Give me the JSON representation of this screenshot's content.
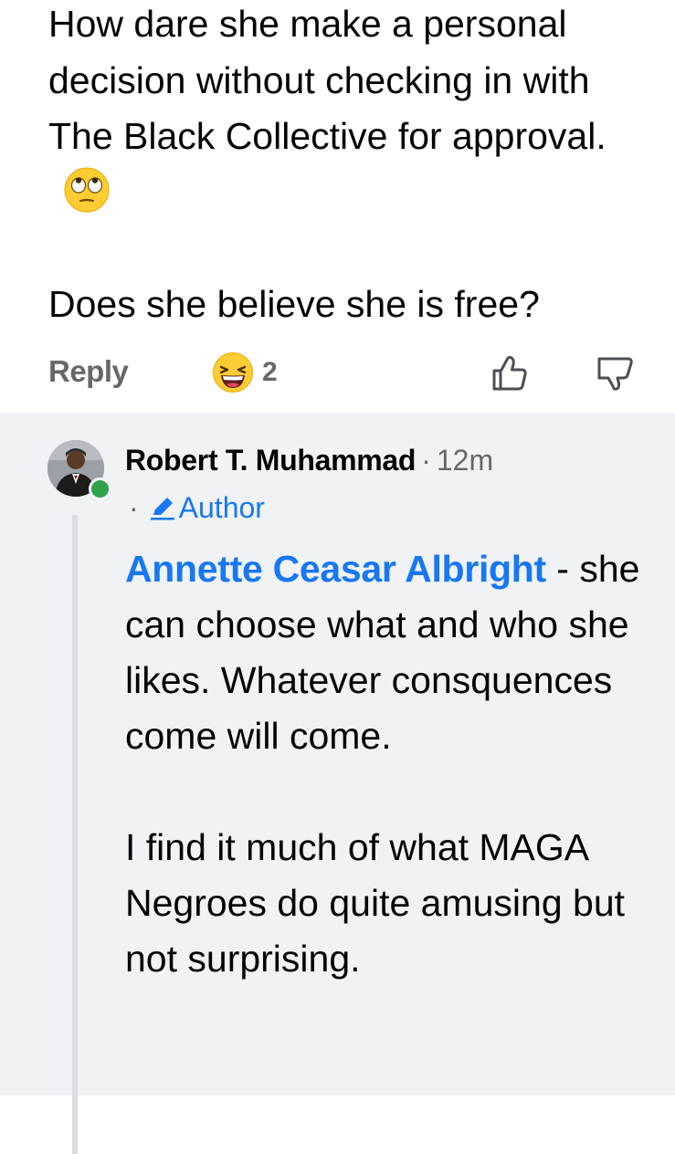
{
  "parent_comment": {
    "paragraph_1": "How dare she make a personal decision without checking in with The Black Collective for approval.",
    "paragraph_1_emoji": "face-with-rolling-eyes",
    "paragraph_2": "Does she believe she is free?",
    "reply_label": "Reply",
    "reaction_emoji": "grinning-squinting-face",
    "reaction_count": "2",
    "like_icon": "thumbs-up-outline-icon",
    "dislike_icon": "thumbs-down-outline-icon"
  },
  "reply": {
    "author_name": "Robert T. Muhammad",
    "separator": "·",
    "timestamp": "12m",
    "badge_separator": "·",
    "badge_label": "Author",
    "badge_icon": "pencil-icon",
    "mention": "Annette Ceasar Albright",
    "mention_suffix": " - she can choose what and who she likes. Whatever consquences come will come.",
    "paragraph_2": "I find it much of what MAGA Negroes do quite amusing but not surprising.",
    "online_status_color": "#31a24c"
  },
  "colors": {
    "link_blue": "#1877f2",
    "secondary_text": "#65676b",
    "thread_background": "#f0f2f5",
    "primary_text": "#050505"
  }
}
